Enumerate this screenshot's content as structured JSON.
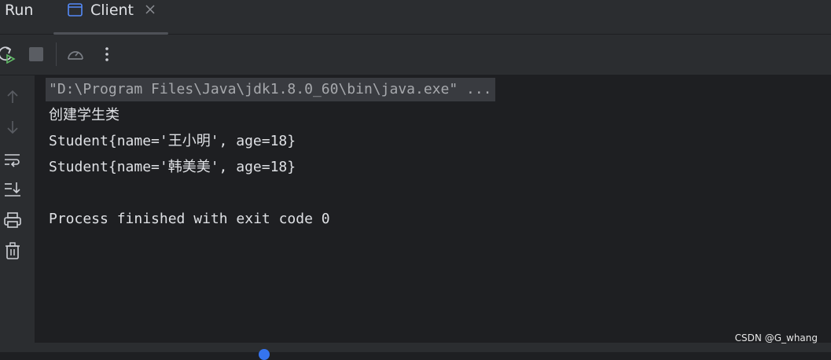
{
  "header": {
    "panel_title": "Run",
    "tab": {
      "label": "Client",
      "icon": "application-window-icon",
      "close_icon": "close-icon"
    }
  },
  "toolbar": {
    "buttons": [
      {
        "icon": "rerun-icon"
      },
      {
        "icon": "stop-icon"
      },
      {
        "icon": "profiler-gauge-icon"
      },
      {
        "icon": "more-vertical-icon"
      }
    ]
  },
  "sidebar": {
    "buttons": [
      {
        "icon": "arrow-up-icon"
      },
      {
        "icon": "arrow-down-icon"
      },
      {
        "icon": "soft-wrap-icon"
      },
      {
        "icon": "scroll-to-end-icon"
      },
      {
        "icon": "print-icon"
      },
      {
        "icon": "trash-icon"
      }
    ]
  },
  "console": {
    "command": "\"D:\\Program Files\\Java\\jdk1.8.0_60\\bin\\java.exe\" ...",
    "lines": [
      "创建学生类",
      "Student{name='王小明', age=18}",
      "Student{name='韩美美', age=18}",
      "",
      "Process finished with exit code 0"
    ]
  },
  "watermark": "CSDN @G_whang",
  "colors": {
    "background": "#1e1f22",
    "panel": "#2b2d30",
    "text": "#dfe1e5",
    "icon": "#ced0d6",
    "rerun_accent": "#5fb865",
    "tab_icon_accent": "#548af7"
  }
}
